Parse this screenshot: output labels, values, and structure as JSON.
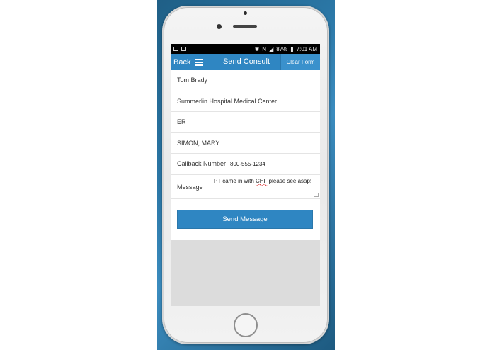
{
  "status_bar": {
    "battery": "87%",
    "time": "7:01 AM"
  },
  "app_bar": {
    "back_label": "Back",
    "title": "Send Consult",
    "clear_label": "Clear Form"
  },
  "form": {
    "physician": "Tom Brady",
    "hospital": "Summerlin Hospital Medical Center",
    "unit": "ER",
    "patient": "SIMON, MARY",
    "callback_label": "Callback Number",
    "callback_value": "800-555-1234",
    "message_label": "Message",
    "message_part1": "PT came in with ",
    "message_misspelled": "CHF",
    "message_part2": " please see asap!"
  },
  "send_button": {
    "label": "Send Message"
  }
}
